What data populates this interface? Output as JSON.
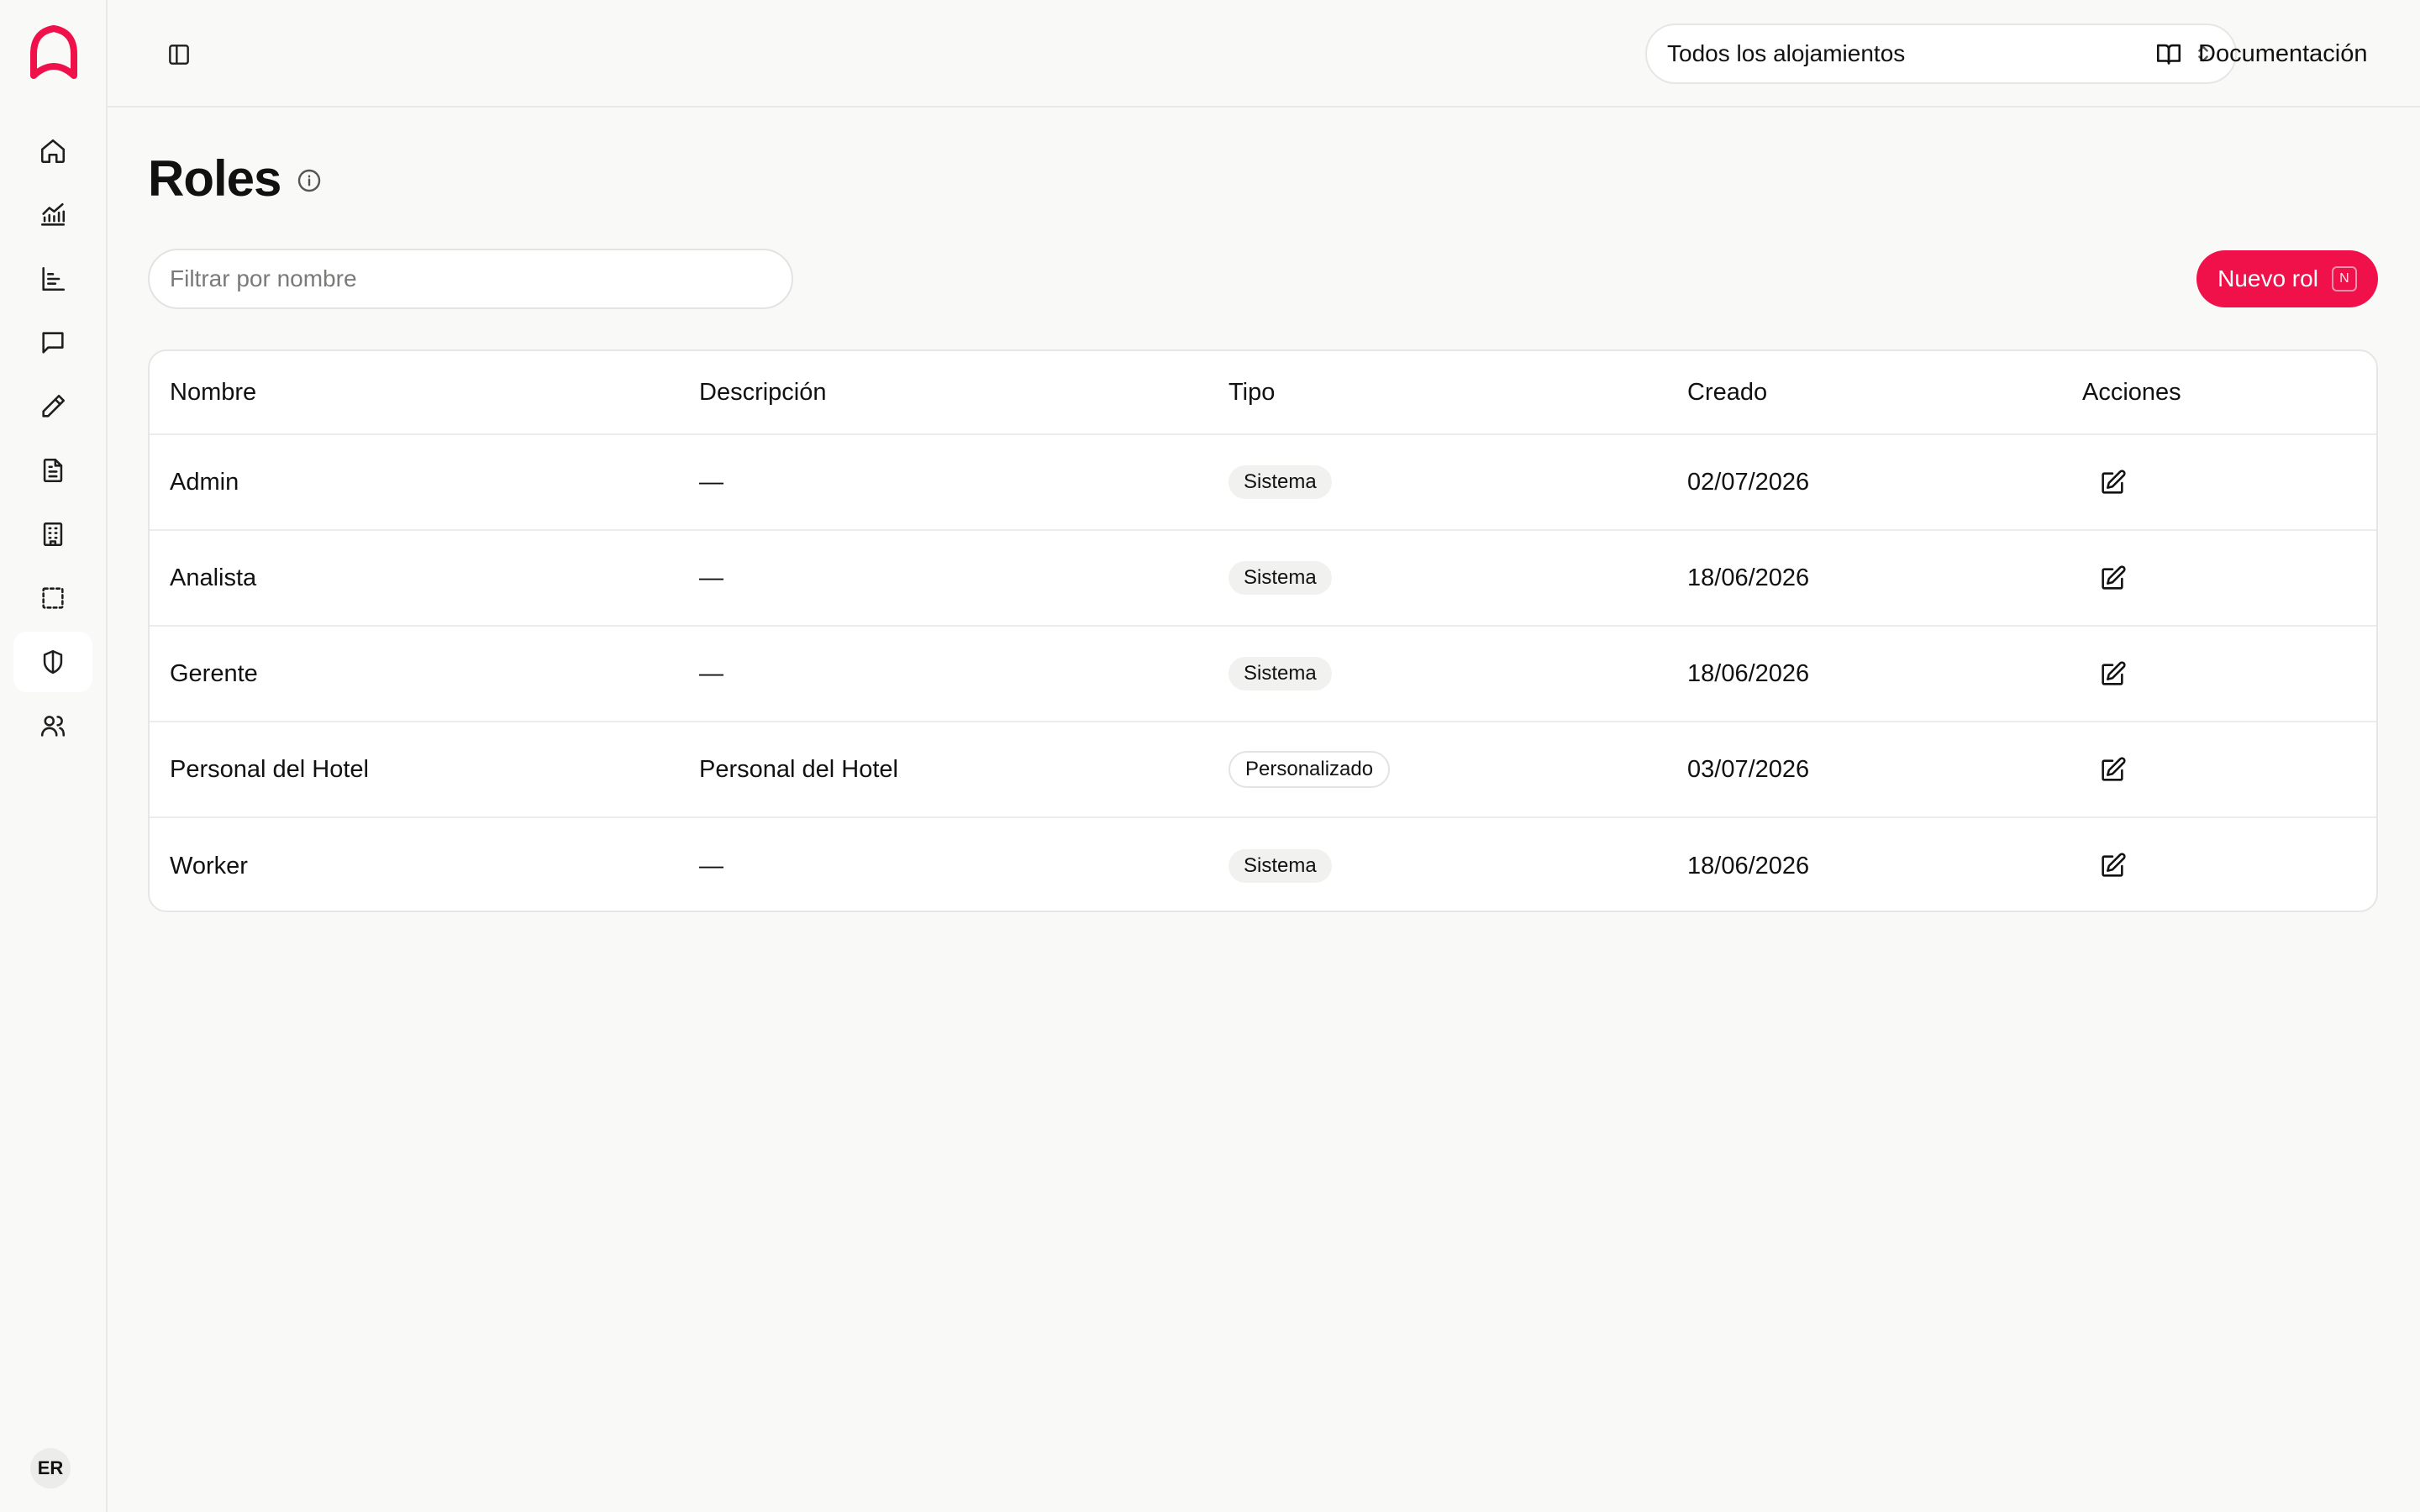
{
  "brand": {
    "accent": "#f0104a"
  },
  "sidebar": {
    "items": [
      {
        "id": "home",
        "icon": "home-icon"
      },
      {
        "id": "analytics",
        "icon": "chart-line-icon"
      },
      {
        "id": "reports",
        "icon": "bar-chart-icon"
      },
      {
        "id": "messages",
        "icon": "message-icon"
      },
      {
        "id": "edit",
        "icon": "pencil-icon"
      },
      {
        "id": "documents",
        "icon": "file-icon"
      },
      {
        "id": "properties",
        "icon": "building-icon"
      },
      {
        "id": "selection",
        "icon": "dashed-square-icon"
      },
      {
        "id": "roles",
        "icon": "shield-icon",
        "active": true
      },
      {
        "id": "users",
        "icon": "users-icon"
      }
    ],
    "user_initials": "ER"
  },
  "topbar": {
    "property_select": "Todos los alojamientos",
    "docs_label": "Documentación"
  },
  "page": {
    "title": "Roles",
    "filter_placeholder": "Filtrar por nombre",
    "new_button_label": "Nuevo rol",
    "new_button_shortcut": "N"
  },
  "table": {
    "headers": [
      "Nombre",
      "Descripción",
      "Tipo",
      "Creado",
      "Acciones"
    ],
    "rows": [
      {
        "name": "Admin",
        "description": "—",
        "type": "Sistema",
        "created": "02/07/2026"
      },
      {
        "name": "Analista",
        "description": "—",
        "type": "Sistema",
        "created": "18/06/2026"
      },
      {
        "name": "Gerente",
        "description": "—",
        "type": "Sistema",
        "created": "18/06/2026"
      },
      {
        "name": "Personal del Hotel",
        "description": "Personal del Hotel",
        "type": "Personalizado",
        "created": "03/07/2026"
      },
      {
        "name": "Worker",
        "description": "—",
        "type": "Sistema",
        "created": "18/06/2026"
      }
    ]
  }
}
